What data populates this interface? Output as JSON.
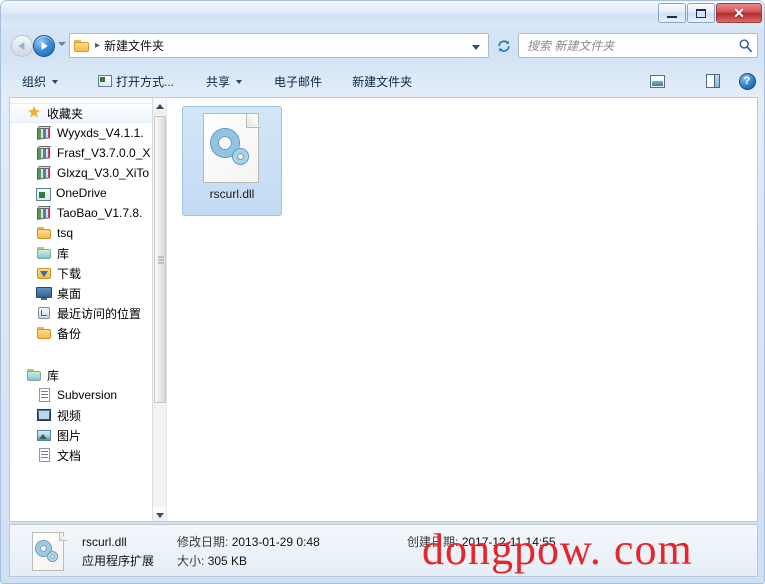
{
  "window": {
    "title": "",
    "buttons": {
      "minimize": "–",
      "maximize": "□",
      "close": "✕"
    }
  },
  "address": {
    "back_icon": "back-arrow-icon",
    "forward_icon": "forward-arrow-icon",
    "history_icon": "history-dropdown-icon",
    "folder_icon": "folder-icon",
    "separator": "▸",
    "path": "新建文件夹",
    "dropdown_icon": "chevron-down-icon",
    "refresh_icon": "refresh-icon"
  },
  "search": {
    "placeholder": "搜索 新建文件夹",
    "icon": "search-icon"
  },
  "toolbar": {
    "organize": "组织",
    "open_with": "打开方式...",
    "share": "共享",
    "email": "电子邮件",
    "new_folder": "新建文件夹",
    "view_icon": "view-options-icon",
    "preview_pane_icon": "preview-pane-icon",
    "help_icon": "help-icon",
    "help_glyph": "?"
  },
  "sidebar": {
    "sections": [
      {
        "label": "收藏夹",
        "icon": "star-icon",
        "items": [
          {
            "label": "Wyyxds_V4.1.1.",
            "icon": "archive-icon"
          },
          {
            "label": "Frasf_V3.7.0.0_X",
            "icon": "archive-icon"
          },
          {
            "label": "Glxzq_V3.0_XiTo",
            "icon": "archive-icon"
          },
          {
            "label": "OneDrive",
            "icon": "app-icon"
          },
          {
            "label": "TaoBao_V1.7.8.",
            "icon": "archive-icon"
          },
          {
            "label": "tsq",
            "icon": "folder-icon"
          },
          {
            "label": "库",
            "icon": "library-icon"
          },
          {
            "label": "下载",
            "icon": "downloads-icon"
          },
          {
            "label": "桌面",
            "icon": "desktop-icon"
          },
          {
            "label": "最近访问的位置",
            "icon": "recent-places-icon"
          },
          {
            "label": "备份",
            "icon": "folder-icon"
          }
        ]
      },
      {
        "label": "库",
        "icon": "library-icon",
        "items": [
          {
            "label": "Subversion",
            "icon": "document-icon"
          },
          {
            "label": "视频",
            "icon": "video-icon"
          },
          {
            "label": "图片",
            "icon": "picture-icon"
          },
          {
            "label": "文档",
            "icon": "document-icon"
          }
        ]
      }
    ],
    "scrollbar": {
      "up_icon": "scroll-up-icon",
      "down_icon": "scroll-down-icon"
    }
  },
  "content": {
    "files": [
      {
        "name": "rscurl.dll",
        "icon": "dll-file-icon",
        "selected": true
      }
    ]
  },
  "status": {
    "icon": "dll-file-icon",
    "name": "rscurl.dll",
    "type": "应用程序扩展",
    "modified_label": "修改日期:",
    "modified_value": "2013-01-29 0:48",
    "size_label": "大小:",
    "size_value": "305 KB",
    "created_label": "创建日期:",
    "created_value": "2017-12-11 14:55"
  },
  "watermark": {
    "text": "dongpow. com",
    "color": "#e8252a"
  },
  "colors": {
    "selection": "#c3dbf3",
    "selection_border": "#9cc4e8",
    "titlebar": "#dceaf8",
    "close_button": "#b52b2b",
    "accent": "#1560a8"
  }
}
